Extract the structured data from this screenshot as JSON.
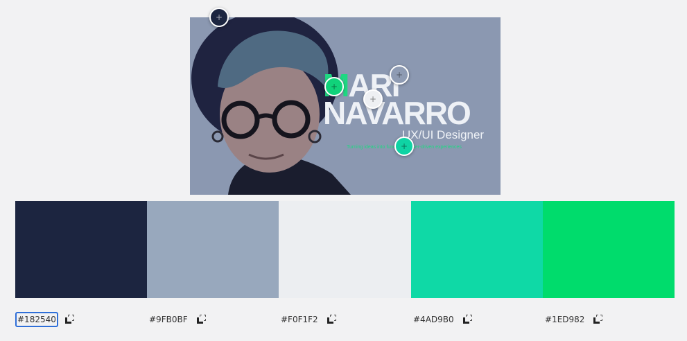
{
  "preview": {
    "name_accent": "M",
    "name_line1_rest": "ARI",
    "name_line2": "NAVARRO",
    "role": "UX/UI Designer",
    "tagline": "Turning ideas into functional, user-driven experiences"
  },
  "palette": [
    {
      "hex": "#182540",
      "color": "#1c2540",
      "selected": true
    },
    {
      "hex": "#9FB0BF",
      "color": "#98a8bd",
      "selected": false
    },
    {
      "hex": "#F0F1F2",
      "color": "#eceef1",
      "selected": false
    },
    {
      "hex": "#4AD9B0",
      "color": "#0fd9a6",
      "selected": false
    },
    {
      "hex": "#1ED982",
      "color": "#00dc6c",
      "selected": false
    }
  ],
  "markers": [
    {
      "color": "#1c2540",
      "icon": "plus-icon"
    },
    {
      "color": "#8e9bb3",
      "icon": "plus-icon"
    },
    {
      "color": "#10d27a",
      "icon": "plus-icon"
    },
    {
      "color": "#eef0f3",
      "icon": "plus-icon"
    },
    {
      "color": "#0fd3a4",
      "icon": "plus-icon"
    }
  ],
  "icons": {
    "copy": "copy-icon"
  }
}
